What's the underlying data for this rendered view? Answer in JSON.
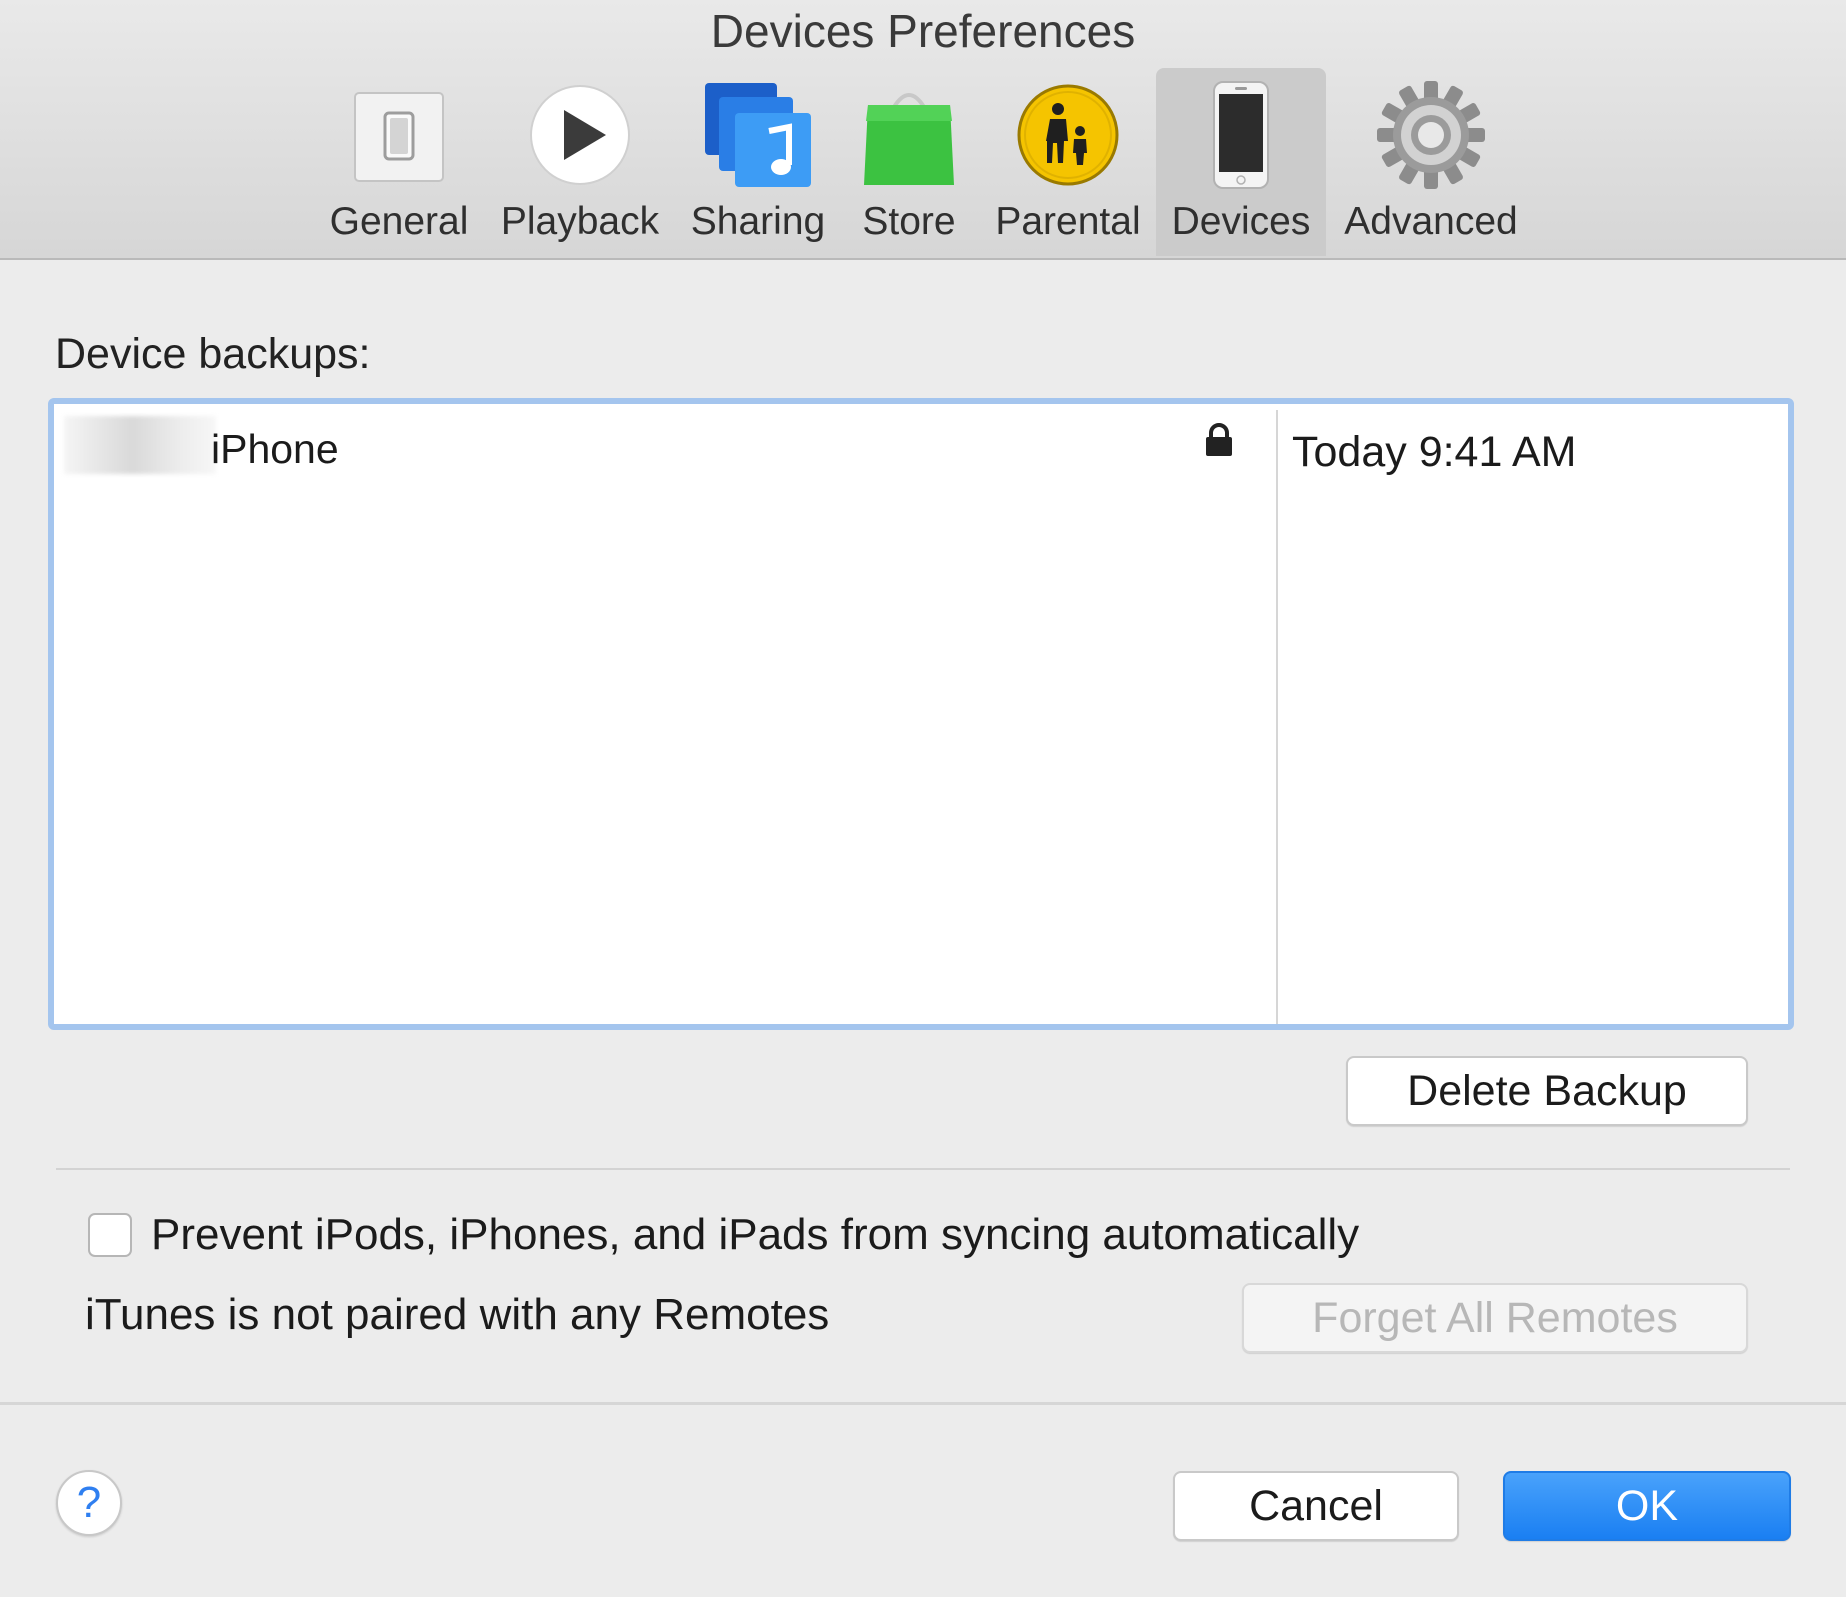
{
  "window": {
    "title": "Devices Preferences"
  },
  "toolbar": {
    "tabs": [
      {
        "label": "General",
        "icon": "general-switch-icon",
        "selected": false
      },
      {
        "label": "Playback",
        "icon": "play-icon",
        "selected": false
      },
      {
        "label": "Sharing",
        "icon": "sharing-music-icon",
        "selected": false
      },
      {
        "label": "Store",
        "icon": "store-bag-icon",
        "selected": false
      },
      {
        "label": "Parental",
        "icon": "parental-icon",
        "selected": false
      },
      {
        "label": "Devices",
        "icon": "iphone-icon",
        "selected": true
      },
      {
        "label": "Advanced",
        "icon": "gear-icon",
        "selected": false
      }
    ]
  },
  "backups": {
    "section_label": "Device backups:",
    "rows": [
      {
        "name": "iPhone",
        "date": "Today 9:41 AM",
        "encrypted": true
      }
    ],
    "delete_label": "Delete Backup"
  },
  "options": {
    "prevent_sync_label": "Prevent iPods, iPhones, and iPads from syncing automatically",
    "prevent_sync_checked": false,
    "remotes_status": "iTunes is not paired with any Remotes",
    "forget_remotes_label": "Forget All Remotes"
  },
  "footer": {
    "help_label": "?",
    "cancel_label": "Cancel",
    "ok_label": "OK"
  },
  "colors": {
    "accent": "#1a7ff2",
    "table_focus_ring": "#a4c5ee",
    "parental_yellow": "#f5c400",
    "store_green": "#3cc241"
  }
}
